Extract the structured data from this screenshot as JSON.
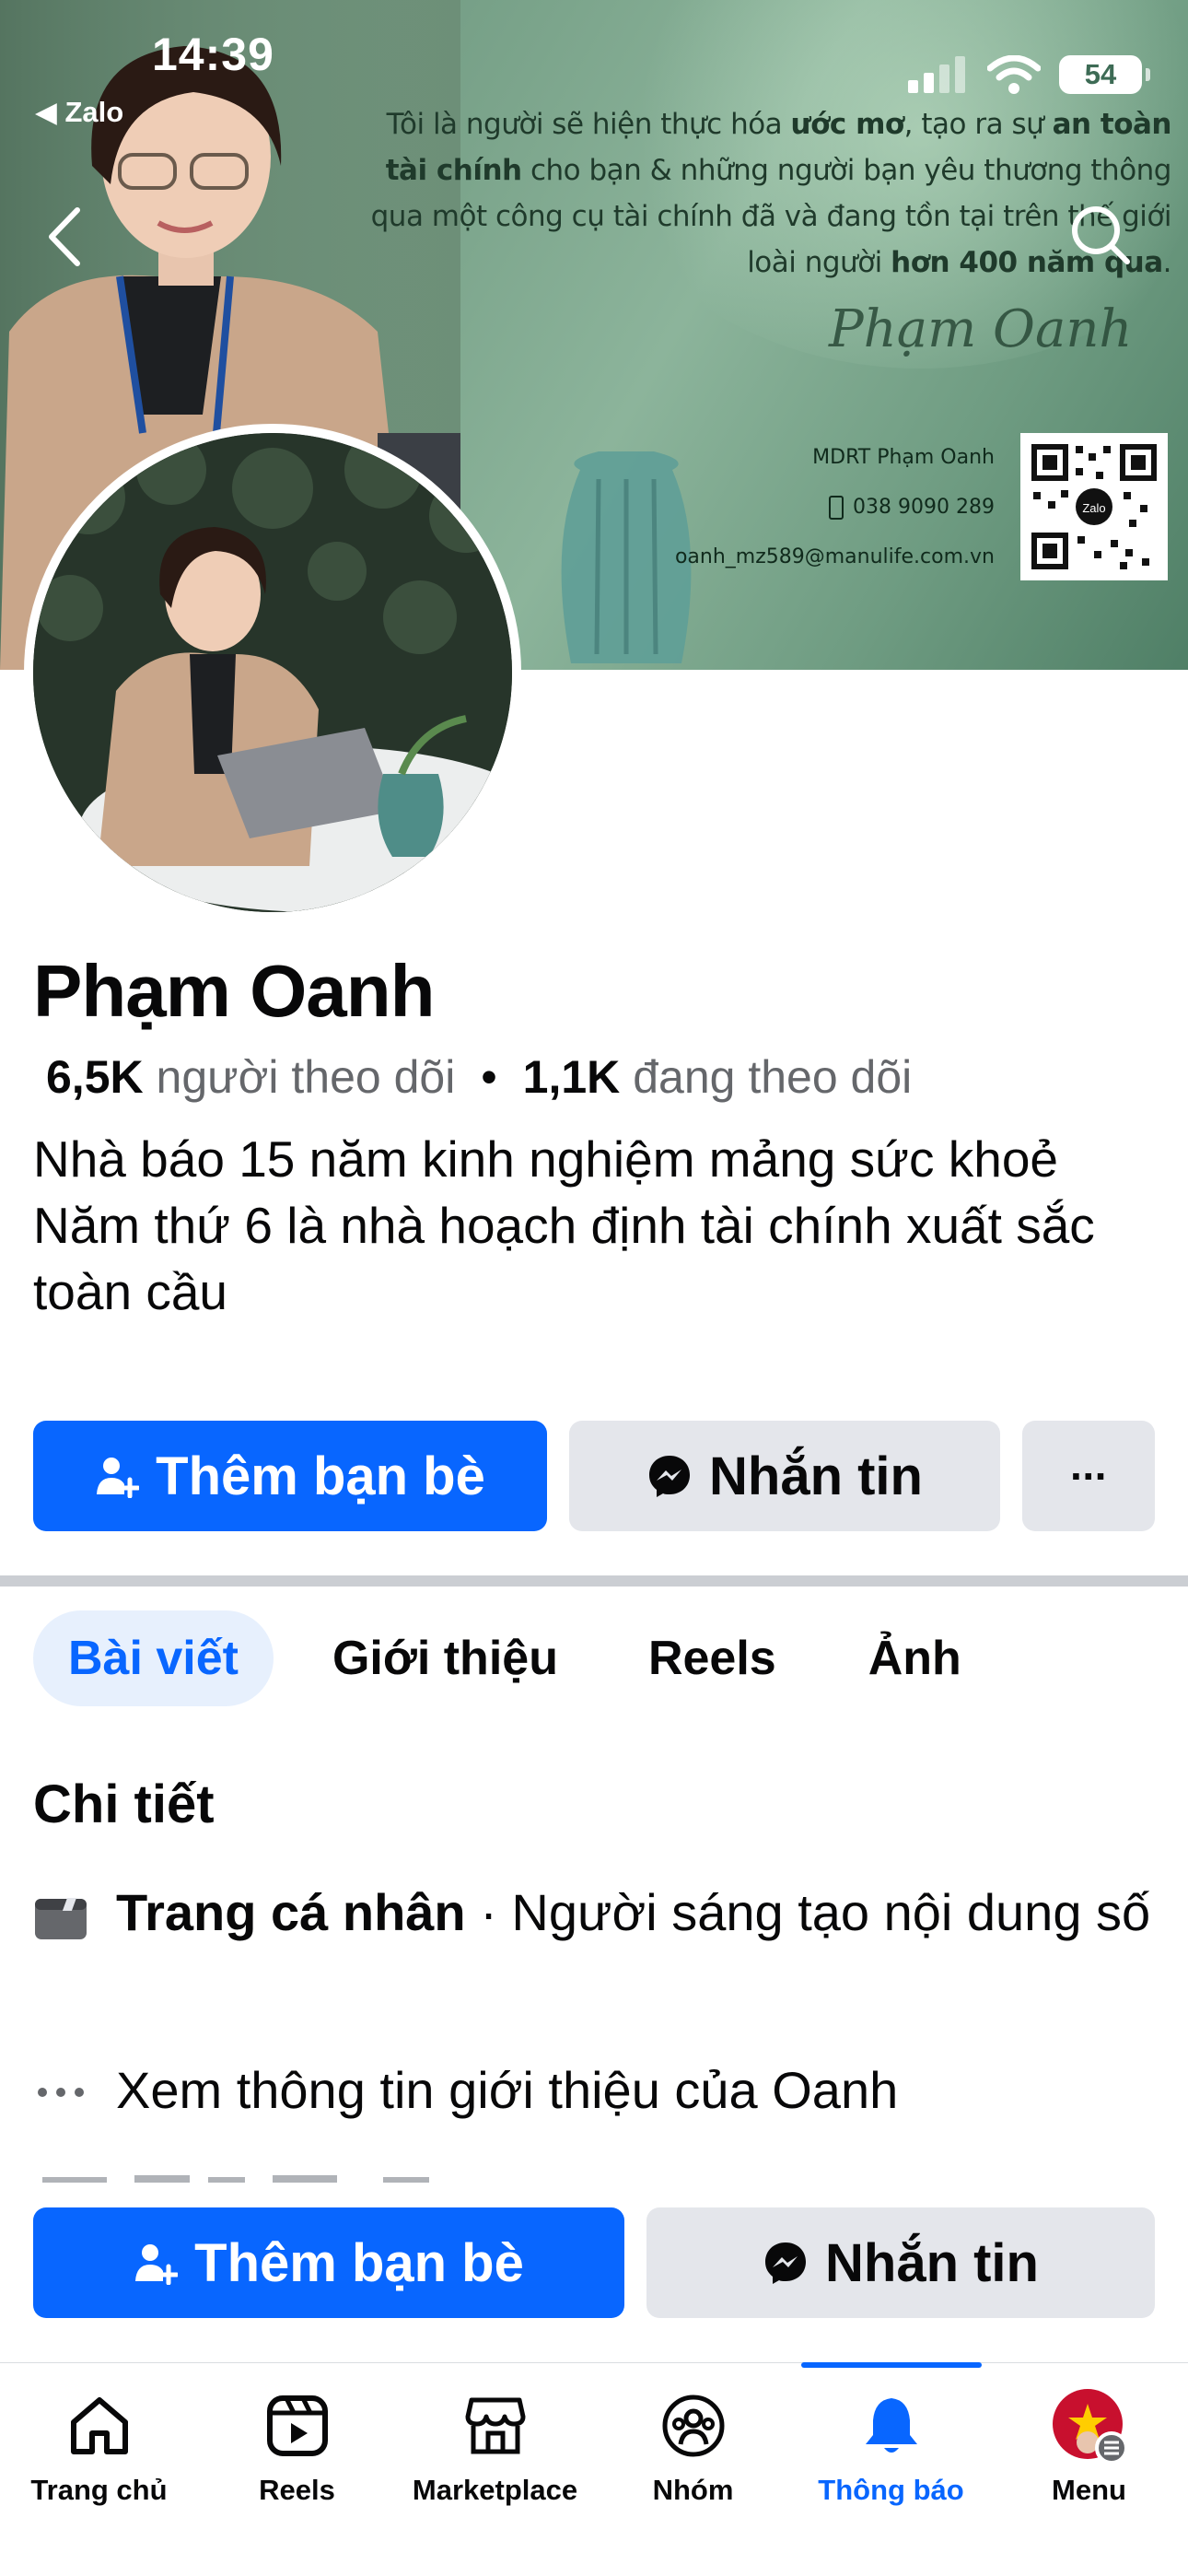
{
  "status_bar": {
    "time": "14:39",
    "back_app": "◀ Zalo",
    "battery": "54"
  },
  "cover": {
    "quote_parts": [
      {
        "t": "Tôi là người sẽ hiện thực hóa ",
        "b": false
      },
      {
        "t": "ước mơ",
        "b": true
      },
      {
        "t": ", tạo ra sự ",
        "b": false
      },
      {
        "t": "an toàn tài chính",
        "b": true
      },
      {
        "t": " cho bạn & những người bạn yêu thương thông qua một công cụ tài chính đã và đang tồn tại trên thế giới loài người ",
        "b": false
      },
      {
        "t": "hơn 400 năm qua",
        "b": true
      },
      {
        "t": ".",
        "b": false
      }
    ],
    "signature": "Phạm Oanh",
    "contact_title": "MDRT Phạm Oanh",
    "phone": "038 9090 289",
    "email": "oanh_mz589@manulife.com.vn",
    "qr_label": "Zalo"
  },
  "profile": {
    "name": "Phạm Oanh",
    "followers_count": "6,5K",
    "followers_label": "người theo dõi",
    "separator": "•",
    "following_count": "1,1K",
    "following_label": "đang theo dõi",
    "bio_lines": [
      "Nhà báo 15 năm kinh nghiệm mảng sức khoẻ",
      "Năm thứ 6 là nhà hoạch định tài chính xuất sắc toàn cầu"
    ]
  },
  "actions": {
    "add_friend": "Thêm bạn bè",
    "message": "Nhắn tin",
    "more": "···"
  },
  "tabs": [
    "Bài viết",
    "Giới thiệu",
    "Reels",
    "Ảnh"
  ],
  "details": {
    "title": "Chi tiết",
    "profile_type_bold": "Trang cá nhân",
    "profile_type_rest": " · Người sáng tạo nội dung số",
    "see_about": "Xem thông tin giới thiệu của Oanh"
  },
  "bottom_nav": [
    {
      "label": "Trang chủ",
      "icon": "home-icon"
    },
    {
      "label": "Reels",
      "icon": "reels-icon"
    },
    {
      "label": "Marketplace",
      "icon": "marketplace-icon"
    },
    {
      "label": "Nhóm",
      "icon": "groups-icon"
    },
    {
      "label": "Thông báo",
      "icon": "bell-icon",
      "active": true
    },
    {
      "label": "Menu",
      "icon": "menu-avatar-icon"
    }
  ],
  "colors": {
    "accent": "#0866ff",
    "button_grey": "#e4e6eb",
    "cover_green": "#7ba48b"
  }
}
